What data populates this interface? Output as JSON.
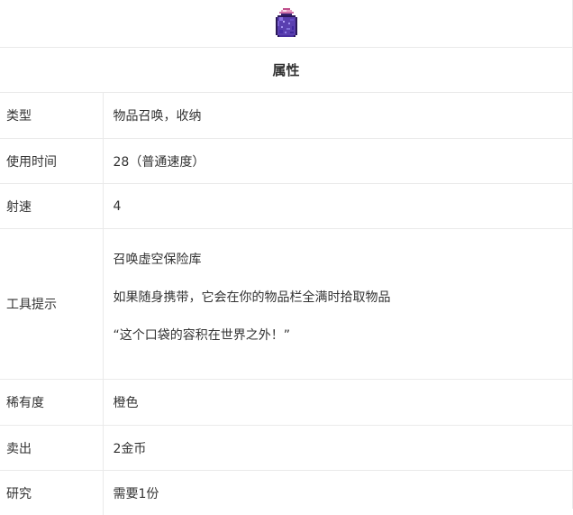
{
  "item": {
    "icon": "void-bag-icon"
  },
  "section_header": "属性",
  "rows": [
    {
      "label": "类型",
      "value": "物品召唤，收纳"
    },
    {
      "label": "使用时间",
      "value": "28（普通速度）"
    },
    {
      "label": "射速",
      "value": "4"
    },
    {
      "label": "工具提示",
      "lines": [
        "召唤虚空保险库",
        "如果随身携带，它会在你的物品栏全满时拾取物品",
        "“这个口袋的容积在世界之外！”"
      ]
    },
    {
      "label": "稀有度",
      "value": "橙色"
    },
    {
      "label": "卖出",
      "value": "2金币"
    },
    {
      "label": "研究",
      "value": "需要1份"
    }
  ],
  "colors": {
    "border": "#eaeaea",
    "text": "#333333",
    "bag_body": "#5a3fb0",
    "bag_top": "#e8a0c8"
  }
}
